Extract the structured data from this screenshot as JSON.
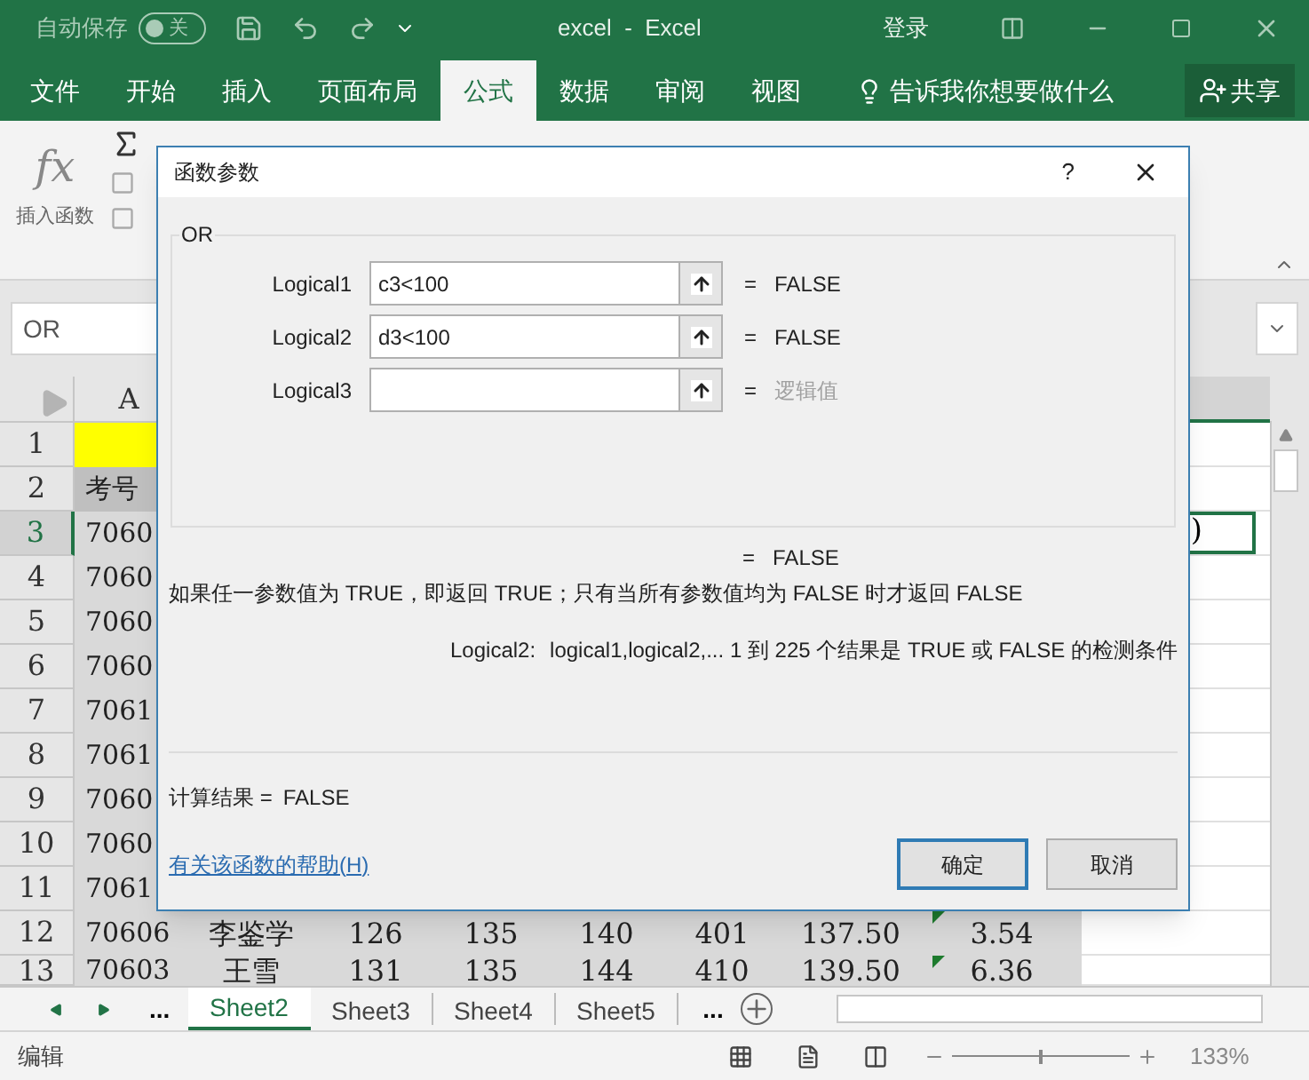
{
  "window": {
    "autosave_label": "自动保存",
    "autosave_toggle": {
      "label": "关",
      "on": false
    },
    "title": "excel  -  Excel",
    "sign_in": "登录"
  },
  "ribbon_tabs": [
    {
      "label": "文件",
      "selected": false
    },
    {
      "label": "开始",
      "selected": false
    },
    {
      "label": "插入",
      "selected": false
    },
    {
      "label": "页面布局",
      "selected": false
    },
    {
      "label": "公式",
      "selected": true
    },
    {
      "label": "数据",
      "selected": false
    },
    {
      "label": "审阅",
      "selected": false
    },
    {
      "label": "视图",
      "selected": false
    }
  ],
  "tell_me": "告诉我你想要做什么",
  "share_button": "共享",
  "ribbon": {
    "function_symbol": "fx",
    "insert_function": "插入函数"
  },
  "name_box": "OR",
  "sheet": {
    "columns": [
      "A"
    ],
    "active_cell": ")",
    "rows": [
      {
        "number": "1",
        "kind": "title",
        "selected": false,
        "flagged": false,
        "cells": []
      },
      {
        "number": "2",
        "kind": "header",
        "selected": false,
        "flagged": false,
        "cells": [
          "考号"
        ]
      },
      {
        "number": "3",
        "kind": "data",
        "selected": true,
        "flagged": false,
        "cells": [
          "7060"
        ]
      },
      {
        "number": "4",
        "kind": "data",
        "selected": false,
        "flagged": false,
        "cells": [
          "7060"
        ]
      },
      {
        "number": "5",
        "kind": "data",
        "selected": false,
        "flagged": false,
        "cells": [
          "7060"
        ]
      },
      {
        "number": "6",
        "kind": "data",
        "selected": false,
        "flagged": false,
        "cells": [
          "7060"
        ]
      },
      {
        "number": "7",
        "kind": "data",
        "selected": false,
        "flagged": false,
        "cells": [
          "7061"
        ]
      },
      {
        "number": "8",
        "kind": "data",
        "selected": false,
        "flagged": false,
        "cells": [
          "7061"
        ]
      },
      {
        "number": "9",
        "kind": "data",
        "selected": false,
        "flagged": false,
        "cells": [
          "7060"
        ]
      },
      {
        "number": "10",
        "kind": "data",
        "selected": false,
        "flagged": false,
        "cells": [
          "7060"
        ]
      },
      {
        "number": "11",
        "kind": "data",
        "selected": false,
        "flagged": false,
        "cells": [
          "7061"
        ]
      },
      {
        "number": "12",
        "kind": "data",
        "selected": false,
        "flagged": true,
        "cells": [
          "70606",
          "李鉴学",
          "126",
          "135",
          "140",
          "401",
          "137.50",
          "3.54"
        ]
      },
      {
        "number": "13",
        "kind": "data",
        "selected": false,
        "flagged": true,
        "cells": [
          "70603",
          "王雪",
          "131",
          "135",
          "144",
          "410",
          "139.50",
          "6.36"
        ]
      }
    ]
  },
  "sheet_tabs": [
    {
      "label": "Sheet2",
      "selected": true
    },
    {
      "label": "Sheet3",
      "selected": false
    },
    {
      "label": "Sheet4",
      "selected": false
    },
    {
      "label": "Sheet5",
      "selected": false
    }
  ],
  "sheet_tabs_overflow_left": "...",
  "sheet_tabs_overflow_right": "...",
  "status_bar": {
    "mode": "编辑",
    "zoom_slider": {
      "level": 0.5
    },
    "zoom": "133%"
  },
  "dialog": {
    "title": "函数参数",
    "help_mark": "?",
    "function_name": "OR",
    "arguments": [
      {
        "label": "Logical1",
        "value": "c3<100",
        "equals": "=",
        "result": "FALSE",
        "hint": false
      },
      {
        "label": "Logical2",
        "value": "d3<100",
        "equals": "=",
        "result": "FALSE",
        "hint": false
      },
      {
        "label": "Logical3",
        "equals": "=",
        "result": "逻辑值",
        "hint": true
      }
    ],
    "formula_result": {
      "equals": "=",
      "value": "FALSE"
    },
    "description": "如果任一参数值为 TRUE，即返回 TRUE；只有当所有参数值均为 FALSE 时才返回 FALSE",
    "argument_help_label": "Logical2:",
    "argument_help": "logical1,logical2,... 1 到 225 个结果是 TRUE 或 FALSE 的检测条件",
    "result_label": "计算结果 =",
    "result": "FALSE",
    "help_link": "有关该函数的帮助(H)",
    "buttons": [
      {
        "label": "确定",
        "default": true
      },
      {
        "label": "取消",
        "default": false
      }
    ]
  }
}
